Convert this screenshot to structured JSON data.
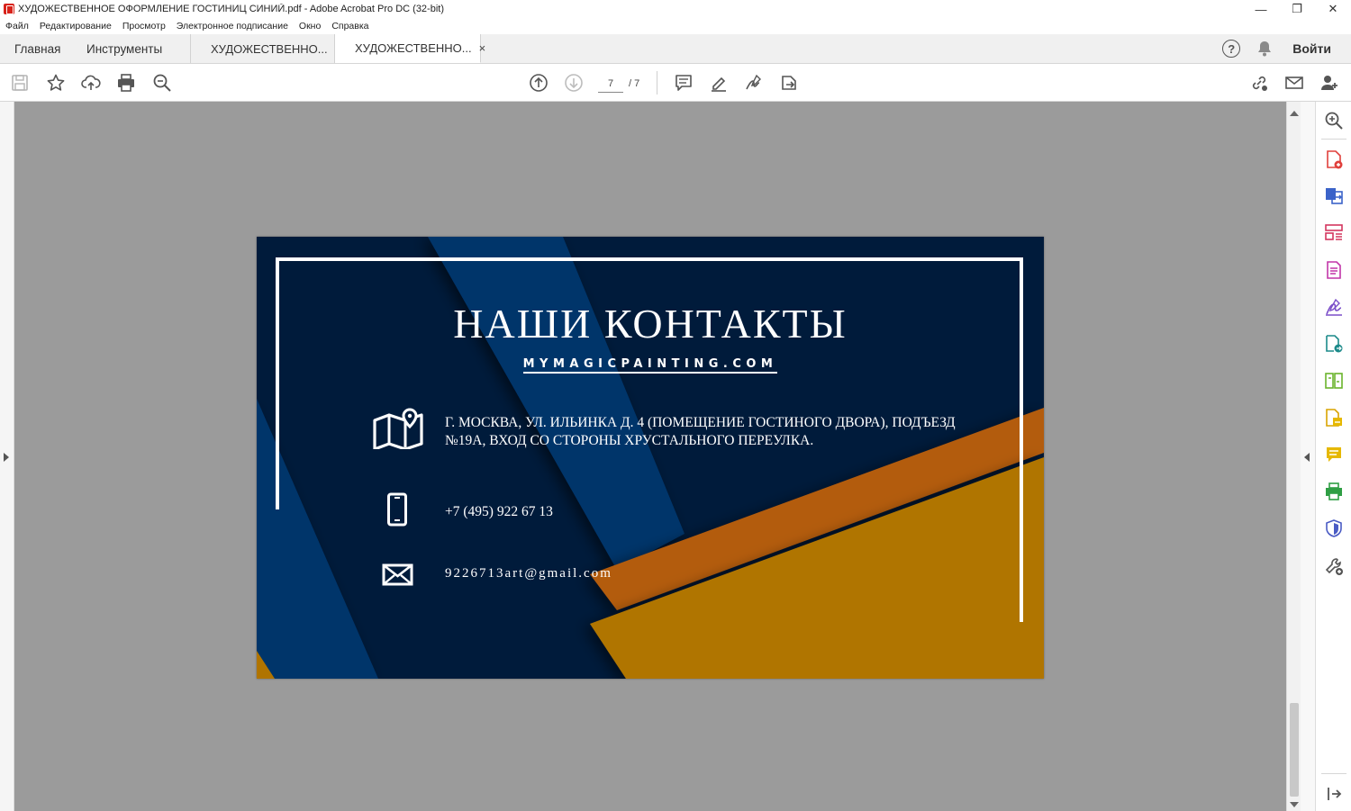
{
  "window": {
    "title": "ХУДОЖЕСТВЕННОЕ ОФОРМЛЕНИЕ ГОСТИНИЦ СИНИЙ.pdf - Adobe Acrobat Pro DC (32-bit)",
    "minimize": "—",
    "restore": "❐",
    "close": "✕"
  },
  "menu": [
    "Файл",
    "Редактирование",
    "Просмотр",
    "Электронное подписание",
    "Окно",
    "Справка"
  ],
  "tabs": {
    "home": "Главная",
    "tools": "Инструменты",
    "doc1": "ХУДОЖЕСТВЕННО...",
    "doc2": "ХУДОЖЕСТВЕННО...",
    "close": "×"
  },
  "header_right": {
    "help": "?",
    "login": "Войти"
  },
  "page_nav": {
    "current": "7",
    "total": "/  7"
  },
  "card": {
    "title": "НАШИ КОНТАКТЫ",
    "website": "MYMAGICPAINTING.COM",
    "address": "Г. МОСКВА, УЛ. ИЛЬИНКА Д. 4 (ПОМЕЩЕНИЕ ГОСТИНОГО ДВОРА), ПОДЪЕЗД №19А, ВХОД СО СТОРОНЫ ХРУСТАЛЬНОГО ПЕРЕУЛКА.",
    "phone": "+7  (495) 922 67 13",
    "email": "9226713art@gmail.com"
  },
  "colors": {
    "card_navy": "#001b3b",
    "card_blue": "#06356a",
    "card_orange": "#b35c0c",
    "card_gold": "#b07400",
    "doc_background": "#9b9b9b"
  }
}
